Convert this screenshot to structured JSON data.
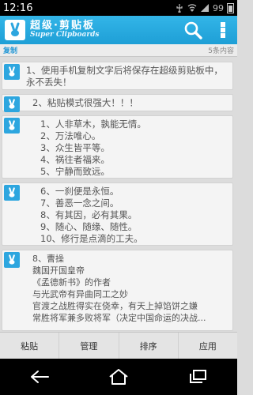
{
  "status_bar": {
    "time": "12:16",
    "signal_text": "99"
  },
  "header": {
    "title": "超级·剪贴板",
    "subtitle": "Super Clipboards"
  },
  "sub_bar": {
    "section_label": "复制",
    "count_label": "5条内容"
  },
  "clips": [
    {
      "text": "1、使用手机复制文字后将保存在超级剪贴板中，永不丢失！"
    },
    {
      "text": "2、粘贴模式很强大！！！"
    },
    {
      "text": "1、人非草木，孰能无情。\n2、万法唯心。\n3、众生皆平等。\n4、祸往者福来。\n5、宁静而致远。"
    },
    {
      "text": "6、一刹便是永恒。\n7、善恶一念之间。\n8、有其因，必有其果。\n9、随心、随缘、随性。\n10、修行是点滴的工夫。"
    },
    {
      "text": "8、曹操\n魏国开国皇帝\n《孟德新书》的作者\n与光武帝有异曲同工之妙\n官渡之战胜得实在侥幸，有天上掉馅饼之嫌\n常胜将军兼多败将军（决定中国命运的决战..."
    }
  ],
  "tabs": [
    {
      "label": "粘贴"
    },
    {
      "label": "管理"
    },
    {
      "label": "排序"
    },
    {
      "label": "应用"
    }
  ],
  "colors": {
    "accent": "#2da6df",
    "header": "#1e9fd6"
  }
}
